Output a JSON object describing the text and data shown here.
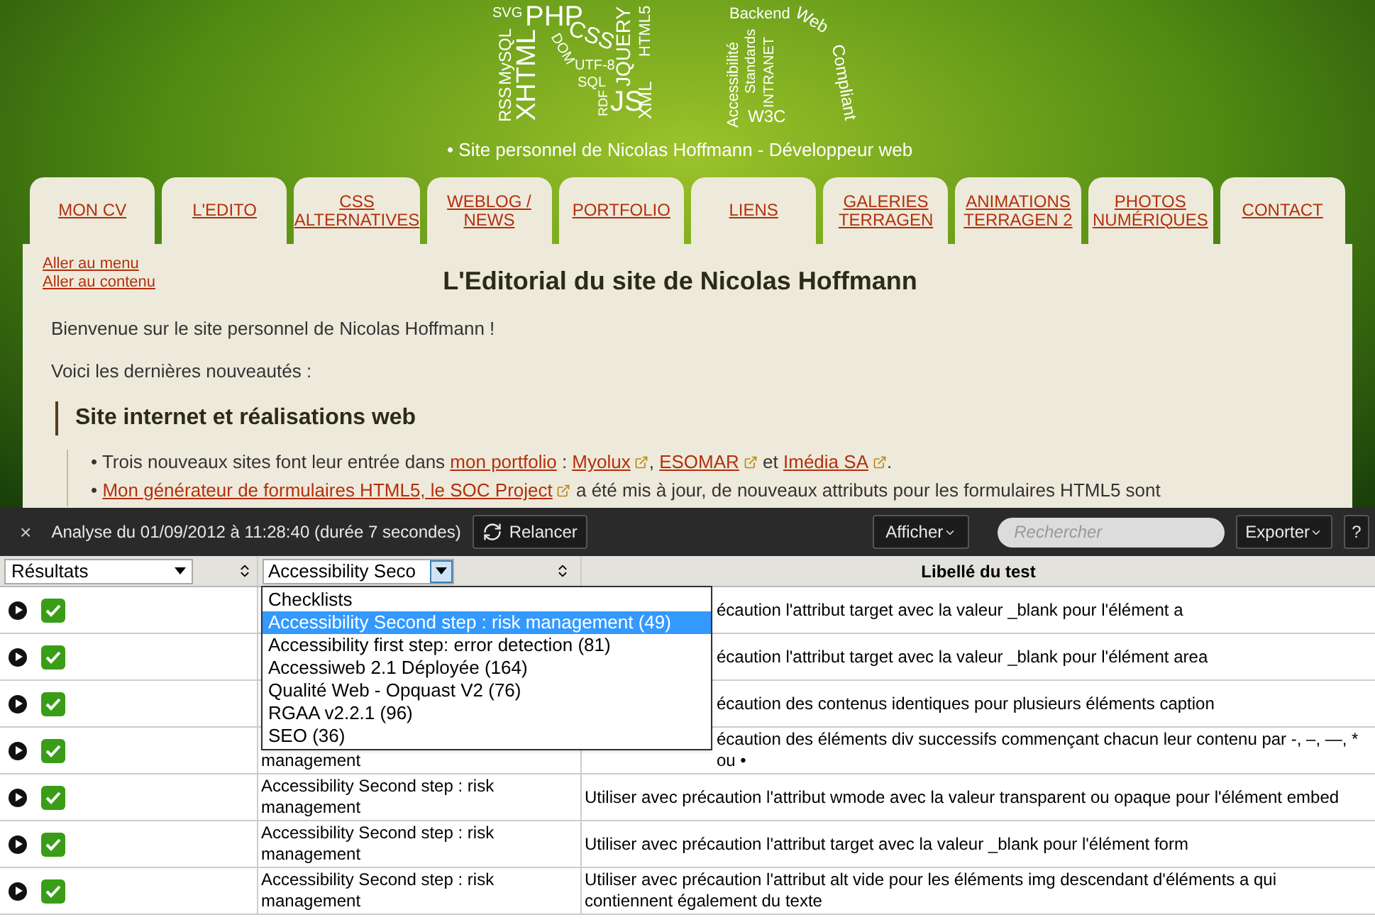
{
  "header": {
    "logo_words": [
      "SVG",
      "PHP",
      "MySQL",
      "XHTML",
      "RSS",
      "DOM",
      "CSS",
      "UTF-8",
      "SQL",
      "RDF",
      "JS",
      "JQUERY",
      "XML",
      "HTML5",
      "Backend",
      "Web",
      "Compliant",
      "Accessibilité",
      "Standards",
      "INTRANET",
      "W3C"
    ],
    "tagline": "• Site personnel de Nicolas Hoffmann - Développeur web"
  },
  "nav": [
    {
      "lines": [
        "MON CV"
      ]
    },
    {
      "lines": [
        "L'EDITO"
      ]
    },
    {
      "lines": [
        "CSS",
        "ALTERNATIVES"
      ]
    },
    {
      "lines": [
        "WEBLOG /",
        "NEWS"
      ]
    },
    {
      "lines": [
        "PORTFOLIO"
      ]
    },
    {
      "lines": [
        "LIENS"
      ]
    },
    {
      "lines": [
        "GALERIES",
        "TERRAGEN"
      ]
    },
    {
      "lines": [
        "ANIMATIONS",
        "TERRAGEN 2"
      ]
    },
    {
      "lines": [
        "PHOTOS",
        "NUMÉRIQUES"
      ]
    },
    {
      "lines": [
        "CONTACT"
      ]
    }
  ],
  "content": {
    "skip_links": [
      "Aller au menu",
      "Aller au contenu"
    ],
    "title": "L'Editorial du site de Nicolas Hoffmann",
    "paragraphs": [
      "Bienvenue sur le site personnel de Nicolas Hoffmann !",
      "Voici les dernières nouveautés :"
    ],
    "section_heading": "Site internet et réalisations web",
    "bullets": [
      {
        "marker": "•",
        "segments": [
          {
            "text": "Trois nouveaux sites font leur entrée dans ",
            "link": false,
            "external": false
          },
          {
            "text": "mon portfolio",
            "link": true,
            "external": false
          },
          {
            "text": " : ",
            "link": false,
            "external": false
          },
          {
            "text": "Myolux",
            "link": true,
            "external": true
          },
          {
            "text": ", ",
            "link": false,
            "external": false
          },
          {
            "text": "ESOMAR",
            "link": true,
            "external": true
          },
          {
            "text": " et ",
            "link": false,
            "external": false
          },
          {
            "text": "Imédia SA",
            "link": true,
            "external": true
          },
          {
            "text": ".",
            "link": false,
            "external": false
          }
        ]
      },
      {
        "marker": "•",
        "segments": [
          {
            "text": "Mon générateur de formulaires HTML5, le SOC Project",
            "link": true,
            "external": true
          },
          {
            "text": " a été mis à jour, de nouveaux attributs pour les formulaires HTML5 sont",
            "link": false,
            "external": false
          }
        ]
      }
    ]
  },
  "panel": {
    "close": "×",
    "analysis": "Analyse du 01/09/2012 à 11:28:40 (durée 7 secondes)",
    "rerun": "Relancer",
    "show": "Afficher",
    "search": {
      "placeholder": "Rechercher"
    },
    "export": "Exporter",
    "help": "?",
    "filters": {
      "results": "Résultats",
      "checklist": "Accessibility Seco",
      "column_header": "Libellé du test"
    },
    "dropdown": [
      {
        "label": "Checklists",
        "selected": false
      },
      {
        "label": "Accessibility Second step : risk management (49)",
        "selected": true
      },
      {
        "label": "Accessibility first step: error detection (81)",
        "selected": false
      },
      {
        "label": "Accessiweb 2.1 Déployée (164)",
        "selected": false
      },
      {
        "label": "Qualité Web - Opquast V2 (76)",
        "selected": false
      },
      {
        "label": "RGAA v2.2.1 (96)",
        "selected": false
      },
      {
        "label": "SEO (36)",
        "selected": false
      }
    ],
    "rows": [
      {
        "checked": true,
        "covered": true,
        "checklist": [],
        "description": "écaution l'attribut target avec la valeur _blank pour l'élément a"
      },
      {
        "checked": true,
        "covered": true,
        "checklist": [],
        "description": "écaution l'attribut target avec la valeur _blank pour l'élément area"
      },
      {
        "checked": true,
        "covered": true,
        "checklist": [],
        "description": "écaution des contenus identiques pour plusieurs éléments caption"
      },
      {
        "checked": true,
        "covered": true,
        "checklist": [
          "management"
        ],
        "description": "écaution des éléments div successifs commençant chacun leur contenu par -, –, —, * ou •"
      },
      {
        "checked": true,
        "covered": false,
        "checklist": [
          "Accessibility Second step : risk",
          "management"
        ],
        "description": "Utiliser avec précaution l'attribut wmode avec la valeur transparent ou opaque pour l'élément embed"
      },
      {
        "checked": true,
        "covered": false,
        "checklist": [
          "Accessibility Second step : risk",
          "management"
        ],
        "description": "Utiliser avec précaution l'attribut target avec la valeur _blank pour l'élément form"
      },
      {
        "checked": true,
        "covered": false,
        "checklist": [
          "Accessibility Second step : risk",
          "management"
        ],
        "description": "Utiliser avec précaution l'attribut alt vide pour les éléments img descendant d'éléments a qui contiennent également du texte"
      }
    ]
  }
}
